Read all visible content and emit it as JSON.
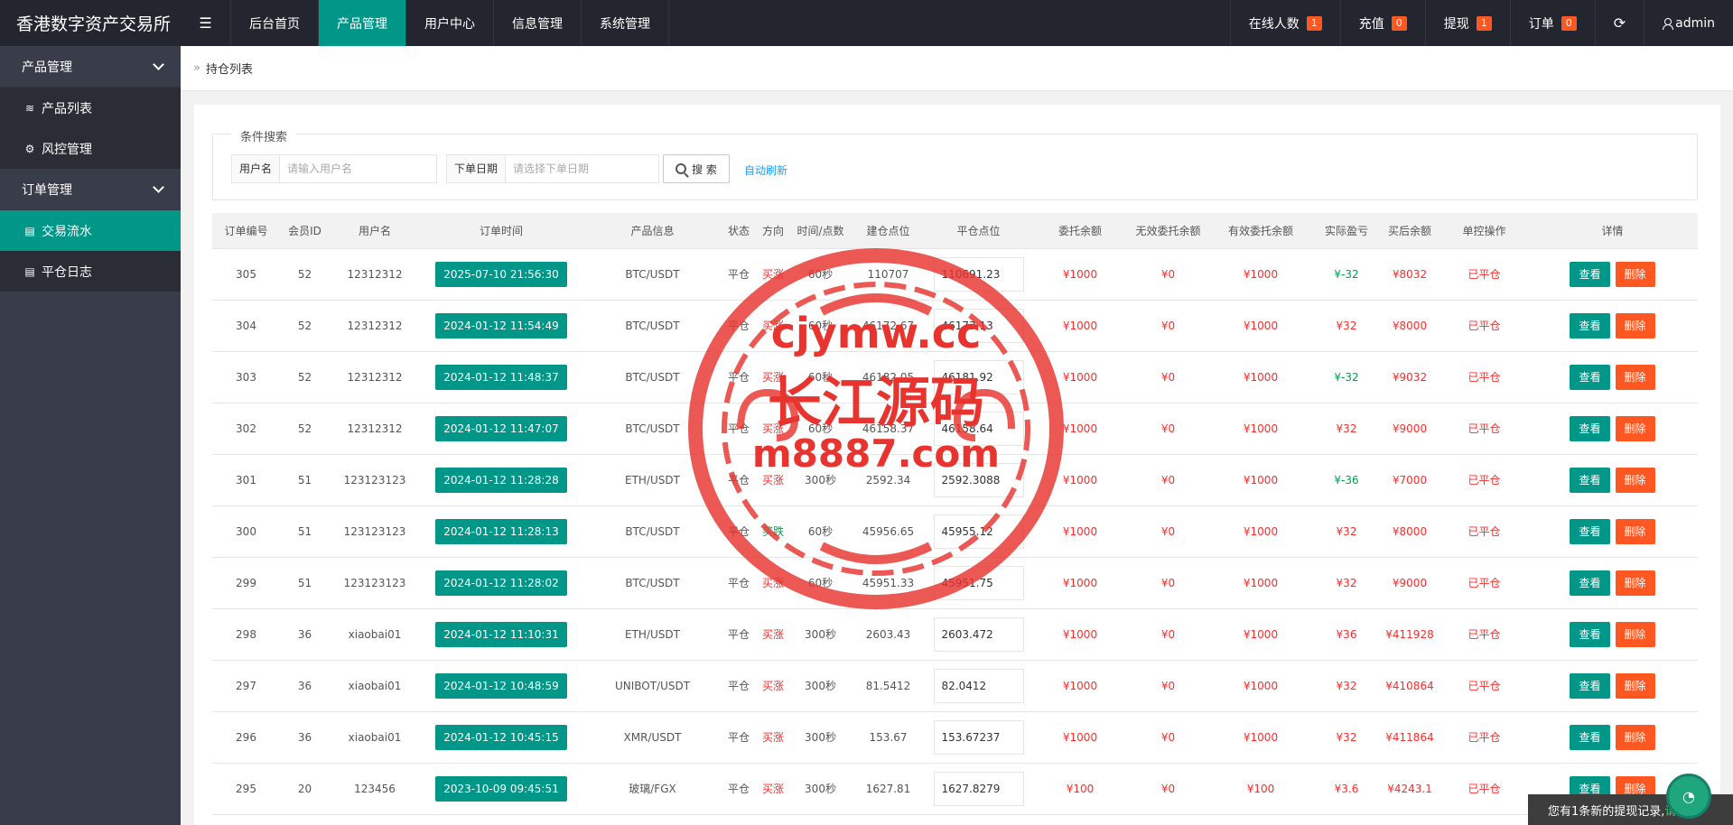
{
  "header": {
    "logo": "香港数字资产交易所",
    "menu_icon": "menu-toggle-icon",
    "nav": [
      {
        "label": "后台首页",
        "active": false
      },
      {
        "label": "产品管理",
        "active": true
      },
      {
        "label": "用户中心",
        "active": false
      },
      {
        "label": "信息管理",
        "active": false
      },
      {
        "label": "系统管理",
        "active": false
      }
    ],
    "right": {
      "online_label": "在线人数",
      "online_count": "1",
      "recharge_label": "充值",
      "recharge_count": "0",
      "withdraw_label": "提现",
      "withdraw_count": "1",
      "order_label": "订单",
      "order_count": "0",
      "refresh_icon": "refresh-icon",
      "user": "admin"
    }
  },
  "sidebar": {
    "groups": [
      {
        "label": "产品管理",
        "items": [
          {
            "label": "产品列表",
            "icon": "layers-icon",
            "active": false
          },
          {
            "label": "风控管理",
            "icon": "gear-icon",
            "active": false
          }
        ]
      },
      {
        "label": "订单管理",
        "items": [
          {
            "label": "交易流水",
            "icon": "document-icon",
            "active": true
          },
          {
            "label": "平仓日志",
            "icon": "document-icon",
            "active": false
          }
        ]
      }
    ]
  },
  "breadcrumb": {
    "sep": "»",
    "current": "持仓列表"
  },
  "search": {
    "legend": "条件搜索",
    "username_label": "用户名",
    "username_placeholder": "请输入用户名",
    "date_label": "下单日期",
    "date_placeholder": "请选择下单日期",
    "search_button": "搜 索",
    "auto_refresh": "自动刷新"
  },
  "table": {
    "columns": [
      "订单编号",
      "会员ID",
      "用户名",
      "订单时间",
      "产品信息",
      "状态",
      "方向",
      "时间/点数",
      "建仓点位",
      "平仓点位",
      "委托余额",
      "无效委托余额",
      "有效委托余额",
      "实际盈亏",
      "买后余额",
      "单控操作",
      "详情"
    ],
    "view_label": "查看",
    "delete_label": "删除",
    "rows": [
      {
        "id": "305",
        "uid": "52",
        "user": "12312312",
        "time": "2025-07-10 21:56:30",
        "product": "BTC/USDT",
        "status": "平仓",
        "dir": "买涨",
        "period": "60秒",
        "open": "110707",
        "close": "110691.23",
        "amount": "¥1000",
        "invalid": "¥0",
        "valid": "¥1000",
        "pnl": "¥-32",
        "pnl_pos": false,
        "after": "¥8032",
        "ctrl": "已平仓"
      },
      {
        "id": "304",
        "uid": "52",
        "user": "12312312",
        "time": "2024-01-12 11:54:49",
        "product": "BTC/USDT",
        "status": "平仓",
        "dir": "买涨",
        "period": "60秒",
        "open": "46172.67",
        "close": "46173.13",
        "amount": "¥1000",
        "invalid": "¥0",
        "valid": "¥1000",
        "pnl": "¥32",
        "pnl_pos": true,
        "after": "¥8000",
        "ctrl": "已平仓"
      },
      {
        "id": "303",
        "uid": "52",
        "user": "12312312",
        "time": "2024-01-12 11:48:37",
        "product": "BTC/USDT",
        "status": "平仓",
        "dir": "买涨",
        "period": "60秒",
        "open": "46182.05",
        "close": "46181.92",
        "amount": "¥1000",
        "invalid": "¥0",
        "valid": "¥1000",
        "pnl": "¥-32",
        "pnl_pos": false,
        "after": "¥9032",
        "ctrl": "已平仓"
      },
      {
        "id": "302",
        "uid": "52",
        "user": "12312312",
        "time": "2024-01-12 11:47:07",
        "product": "BTC/USDT",
        "status": "平仓",
        "dir": "买涨",
        "period": "60秒",
        "open": "46158.37",
        "close": "46158.64",
        "amount": "¥1000",
        "invalid": "¥0",
        "valid": "¥1000",
        "pnl": "¥32",
        "pnl_pos": true,
        "after": "¥9000",
        "ctrl": "已平仓"
      },
      {
        "id": "301",
        "uid": "51",
        "user": "123123123",
        "time": "2024-01-12 11:28:28",
        "product": "ETH/USDT",
        "status": "平仓",
        "dir": "买涨",
        "period": "300秒",
        "open": "2592.34",
        "close": "2592.3088",
        "amount": "¥1000",
        "invalid": "¥0",
        "valid": "¥1000",
        "pnl": "¥-36",
        "pnl_pos": false,
        "after": "¥7000",
        "ctrl": "已平仓"
      },
      {
        "id": "300",
        "uid": "51",
        "user": "123123123",
        "time": "2024-01-12 11:28:13",
        "product": "BTC/USDT",
        "status": "平仓",
        "dir": "买跌",
        "period": "60秒",
        "open": "45956.65",
        "close": "45955.12",
        "amount": "¥1000",
        "invalid": "¥0",
        "valid": "¥1000",
        "pnl": "¥32",
        "pnl_pos": true,
        "after": "¥8000",
        "ctrl": "已平仓"
      },
      {
        "id": "299",
        "uid": "51",
        "user": "123123123",
        "time": "2024-01-12 11:28:02",
        "product": "BTC/USDT",
        "status": "平仓",
        "dir": "买涨",
        "period": "60秒",
        "open": "45951.33",
        "close": "45951.75",
        "amount": "¥1000",
        "invalid": "¥0",
        "valid": "¥1000",
        "pnl": "¥32",
        "pnl_pos": true,
        "after": "¥9000",
        "ctrl": "已平仓"
      },
      {
        "id": "298",
        "uid": "36",
        "user": "xiaobai01",
        "time": "2024-01-12 11:10:31",
        "product": "ETH/USDT",
        "status": "平仓",
        "dir": "买涨",
        "period": "300秒",
        "open": "2603.43",
        "close": "2603.472",
        "amount": "¥1000",
        "invalid": "¥0",
        "valid": "¥1000",
        "pnl": "¥36",
        "pnl_pos": true,
        "after": "¥411928",
        "ctrl": "已平仓"
      },
      {
        "id": "297",
        "uid": "36",
        "user": "xiaobai01",
        "time": "2024-01-12 10:48:59",
        "product": "UNIBOT/USDT",
        "status": "平仓",
        "dir": "买涨",
        "period": "300秒",
        "open": "81.5412",
        "close": "82.0412",
        "amount": "¥1000",
        "invalid": "¥0",
        "valid": "¥1000",
        "pnl": "¥32",
        "pnl_pos": true,
        "after": "¥410864",
        "ctrl": "已平仓"
      },
      {
        "id": "296",
        "uid": "36",
        "user": "xiaobai01",
        "time": "2024-01-12 10:45:15",
        "product": "XMR/USDT",
        "status": "平仓",
        "dir": "买涨",
        "period": "300秒",
        "open": "153.67",
        "close": "153.67237",
        "amount": "¥1000",
        "invalid": "¥0",
        "valid": "¥1000",
        "pnl": "¥32",
        "pnl_pos": true,
        "after": "¥411864",
        "ctrl": "已平仓"
      },
      {
        "id": "295",
        "uid": "20",
        "user": "123456",
        "time": "2023-10-09 09:45:51",
        "product": "玻璃/FGX",
        "status": "平仓",
        "dir": "买涨",
        "period": "300秒",
        "open": "1627.81",
        "close": "1627.8279",
        "amount": "¥100",
        "invalid": "¥0",
        "valid": "¥100",
        "pnl": "¥3.6",
        "pnl_pos": true,
        "after": "¥4243.1",
        "ctrl": "已平仓"
      }
    ]
  },
  "notice": {
    "text": "您有1条新的提现记录,",
    "link": "请查看"
  },
  "watermark": {
    "line1": "cjymw.cc",
    "line2": "长江源码",
    "line3": "m8887.com"
  }
}
